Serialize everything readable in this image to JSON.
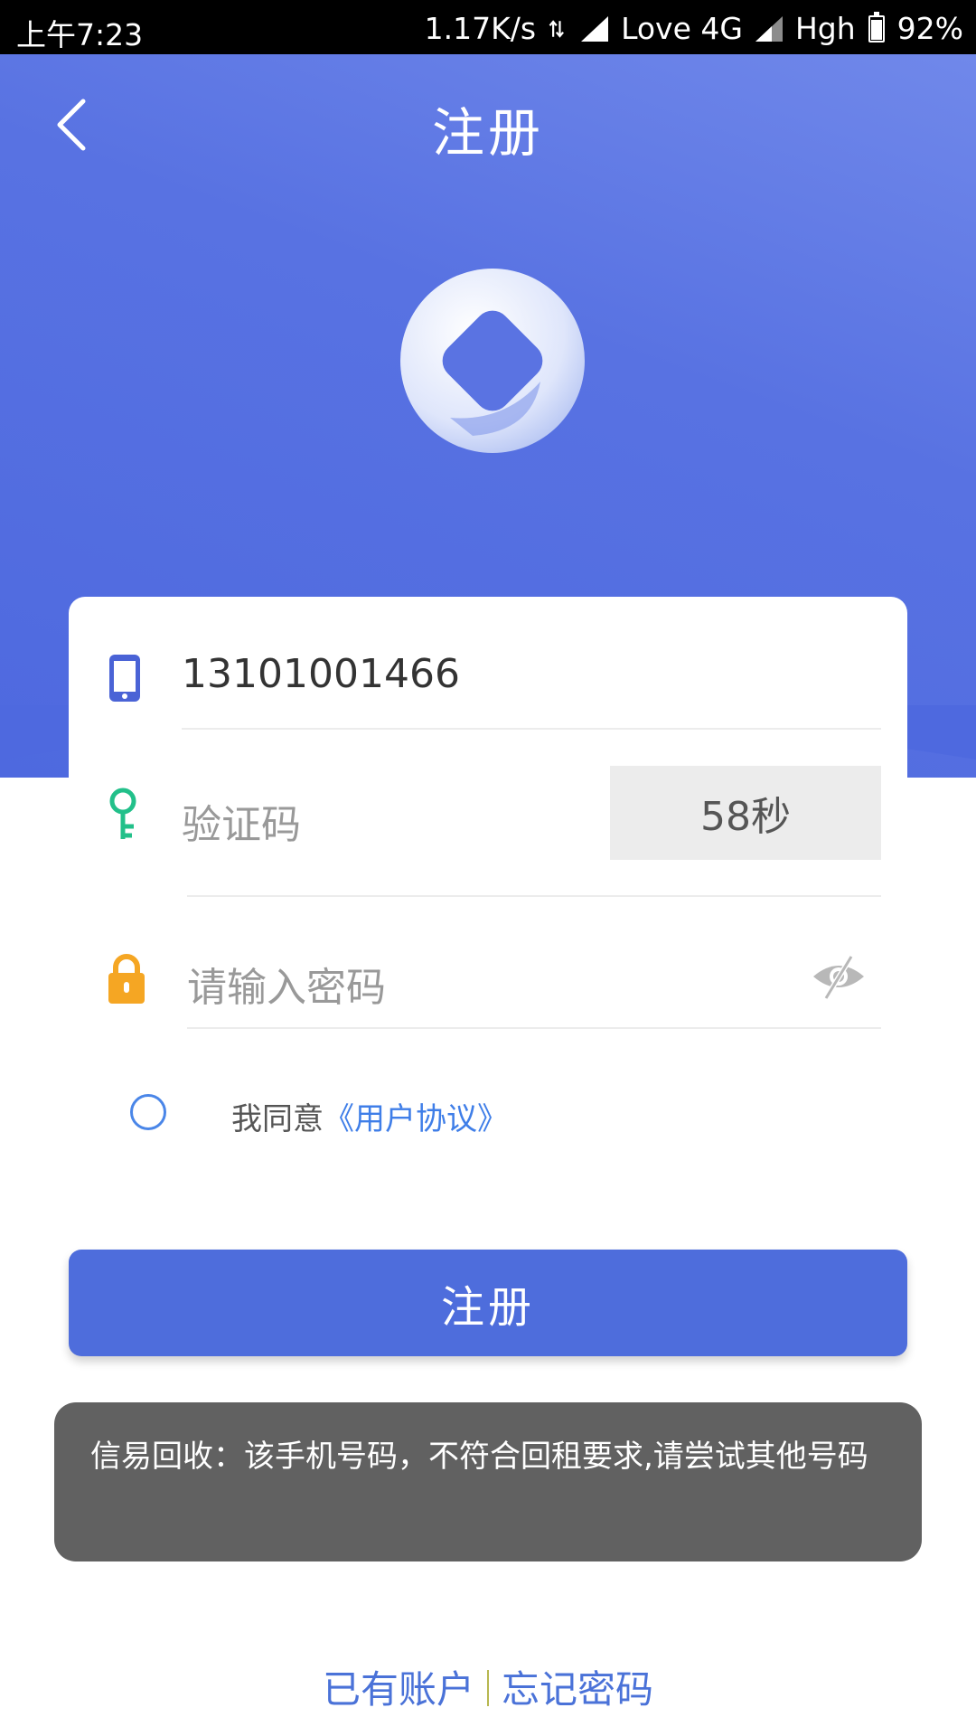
{
  "status_bar": {
    "time": "上午7:23",
    "speed": "1.17K/s",
    "carrier1": "Love 4G",
    "carrier2": "Hgh",
    "battery": "92%"
  },
  "header": {
    "title": "注册",
    "back_icon": "chevron-left-icon",
    "logo_icon": "app-logo"
  },
  "form": {
    "phone": {
      "icon": "phone-icon",
      "value": "13101001466"
    },
    "code": {
      "icon": "key-icon",
      "placeholder": "验证码",
      "countdown": "58秒"
    },
    "password": {
      "icon": "lock-icon",
      "placeholder": "请输入密码",
      "toggle_icon": "eye-off-icon"
    },
    "agree": {
      "prefix": "我同意",
      "link": "《用户协议》",
      "checked": false
    }
  },
  "submit_label": "注册",
  "toast": "信易回收：该手机号码，不符合回租要求,请尝试其他号码",
  "bottom": {
    "login_link": "已有账户",
    "forgot_link": "忘记密码"
  },
  "colors": {
    "primary": "#4e6ddc",
    "phone_icon": "#4a63d6",
    "key_icon": "#22c08a",
    "lock_icon": "#f5a623",
    "link": "#3f7ee8"
  }
}
